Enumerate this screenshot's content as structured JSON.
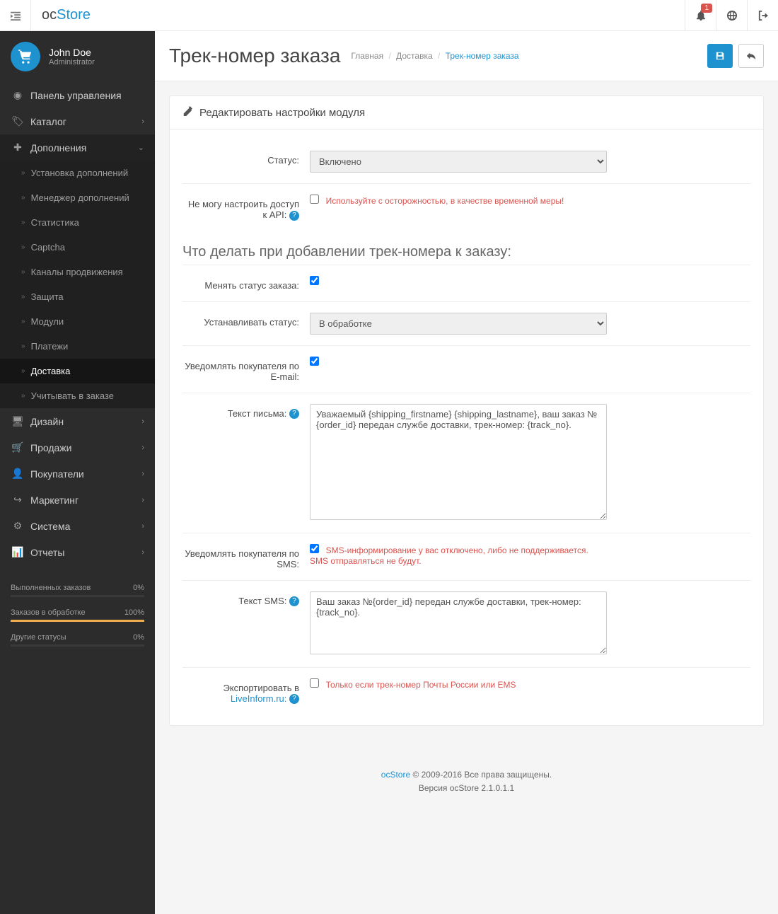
{
  "brand": {
    "part1": "oc",
    "part2": "Store"
  },
  "header": {
    "notif_count": "1"
  },
  "user": {
    "name": "John Doe",
    "role": "Administrator"
  },
  "nav": {
    "dashboard": "Панель управления",
    "catalog": "Каталог",
    "extensions": "Дополнения",
    "design": "Дизайн",
    "sales": "Продажи",
    "customers": "Покупатели",
    "marketing": "Маркетинг",
    "system": "Система",
    "reports": "Отчеты"
  },
  "subnav": {
    "installer": "Установка дополнений",
    "manager": "Менеджер дополнений",
    "analytics": "Статистика",
    "captcha": "Captcha",
    "feeds": "Каналы продвижения",
    "antifraud": "Защита",
    "modules": "Модули",
    "payments": "Платежи",
    "shipping": "Доставка",
    "totals": "Учитывать в заказе"
  },
  "stats": [
    {
      "label": "Выполненных заказов",
      "value": "0%",
      "pct": 0
    },
    {
      "label": "Заказов в обработке",
      "value": "100%",
      "pct": 100
    },
    {
      "label": "Другие статусы",
      "value": "0%",
      "pct": 0
    }
  ],
  "page": {
    "title": "Трек-номер заказа",
    "breadcrumb": {
      "home": "Главная",
      "shipping": "Доставка",
      "current": "Трек-номер заказа"
    },
    "panel_title": "Редактировать настройки модуля"
  },
  "form": {
    "status_label": "Статус:",
    "status_value": "Включено",
    "api_label": "Не могу настроить доступ к API:",
    "api_warning": "Используйте с осторожностью, в качестве временной меры!",
    "section_title": "Что делать при добавлении трек-номера к заказу:",
    "change_status_label": "Менять статус заказа:",
    "set_status_label": "Устанавливать статус:",
    "set_status_value": "В обработке",
    "notify_email_label": "Уведомлять покупателя по E-mail:",
    "email_text_label": "Текст письма:",
    "email_text_value": "Уважаемый {shipping_firstname} {shipping_lastname}, ваш заказ №{order_id} передан службе доставки, трек-номер: {track_no}.",
    "notify_sms_label": "Уведомлять покупателя по SMS:",
    "sms_warning": "SMS-информирование у вас отключено, либо не поддерживается. SMS отправляться не будут.",
    "sms_text_label": "Текст SMS:",
    "sms_text_value": "Ваш заказ №{order_id} передан службе доставки, трек-номер: {track_no}.",
    "export_label_1": "Экспортировать в",
    "export_label_2": "LiveInform.ru:",
    "export_hint": "Только если трек-номер Почты России или EMS"
  },
  "footer": {
    "brand": "ocStore",
    "copy": " © 2009-2016 Все права защищены.",
    "version": "Версия ocStore 2.1.0.1.1"
  }
}
